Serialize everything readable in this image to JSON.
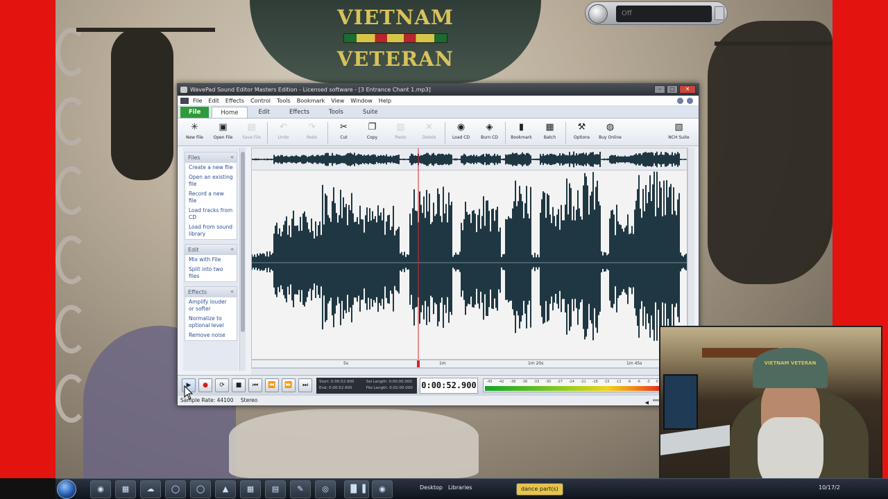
{
  "desktop": {
    "cap_top": "VIETNAM",
    "cap_bottom": "VETERAN",
    "gadget_text": "Off"
  },
  "window": {
    "title": "WavePad Sound Editor Masters Edition - Licensed software - [3 Entrance Chant 1.mp3]",
    "menu": [
      "File",
      "Edit",
      "Effects",
      "Control",
      "Tools",
      "Bookmark",
      "View",
      "Window",
      "Help"
    ],
    "tabs": [
      "File",
      "Home",
      "Edit",
      "Effects",
      "Tools",
      "Suite"
    ],
    "active_tab": "Home",
    "toolbar": [
      {
        "label": "New File",
        "icon": "new-file-icon",
        "glyph": "✳",
        "dim": false
      },
      {
        "label": "Open File",
        "icon": "open-file-icon",
        "glyph": "▣",
        "dim": false
      },
      {
        "label": "Save File",
        "icon": "save-icon",
        "glyph": "▤",
        "dim": true
      },
      {
        "label": "Undo",
        "icon": "undo-icon",
        "glyph": "↶",
        "dim": true
      },
      {
        "label": "Redo",
        "icon": "redo-icon",
        "glyph": "↷",
        "dim": true
      },
      {
        "label": "Cut",
        "icon": "cut-icon",
        "glyph": "✂",
        "dim": false
      },
      {
        "label": "Copy",
        "icon": "copy-icon",
        "glyph": "❐",
        "dim": false
      },
      {
        "label": "Paste",
        "icon": "paste-icon",
        "glyph": "▥",
        "dim": true
      },
      {
        "label": "Delete",
        "icon": "delete-icon",
        "glyph": "✕",
        "dim": true
      },
      {
        "label": "Load CD",
        "icon": "load-cd-icon",
        "glyph": "◉",
        "dim": false
      },
      {
        "label": "Burn CD",
        "icon": "burn-cd-icon",
        "glyph": "◈",
        "dim": false
      },
      {
        "label": "Bookmark",
        "icon": "bookmark-icon",
        "glyph": "▮",
        "dim": false
      },
      {
        "label": "Batch",
        "icon": "batch-icon",
        "glyph": "▦",
        "dim": false
      },
      {
        "label": "Options",
        "icon": "options-icon",
        "glyph": "⚒",
        "dim": false
      },
      {
        "label": "Buy Online",
        "icon": "buy-online-icon",
        "glyph": "◍",
        "dim": false
      }
    ],
    "toolbar_right": {
      "label": "NCH Suite",
      "icon": "nch-suite-icon",
      "glyph": "▧"
    },
    "sidebar": [
      {
        "title": "Files",
        "items": [
          "Create a new file",
          "Open an existing file",
          "Record a new file",
          "Load tracks from CD",
          "Load from sound library"
        ]
      },
      {
        "title": "Edit",
        "items": [
          "Mix with File",
          "Split into two files"
        ]
      },
      {
        "title": "Effects",
        "items": [
          "Amplify louder or softer",
          "Normalize to optional level",
          "Remove noise"
        ]
      }
    ],
    "ruler_labels": [
      "5s",
      "1m",
      "1m 20s",
      "1m 45s"
    ],
    "selection": {
      "start": "Start: 0:00:52.900",
      "end": "End: 0:00:52.900",
      "sel_length": "Sel Length: 0:00:00.000",
      "file_length": "File Length: 0:02:00.000"
    },
    "timecode": "0:00:52.900",
    "meter_scale": [
      "-45",
      "-42",
      "-39",
      "-36",
      "-33",
      "-30",
      "-27",
      "-24",
      "-21",
      "-18",
      "-15",
      "-12",
      "-9",
      "-6",
      "-3",
      "0"
    ],
    "status": {
      "sample_rate": "Sample Rate: 44100",
      "channels": "Stereo"
    }
  },
  "webcam": {
    "cap_text": "VIETNAM VETERAN"
  },
  "taskbar": {
    "desktop_label": "Desktop",
    "libraries_label": "Libraries",
    "task_label": "dance part(s)",
    "clock": "10/17/2"
  },
  "colors": {
    "frame_red": "#e3140f",
    "waveform": "#1f3743",
    "playhead": "#e0202a",
    "file_tab": "#2e9a3a"
  }
}
